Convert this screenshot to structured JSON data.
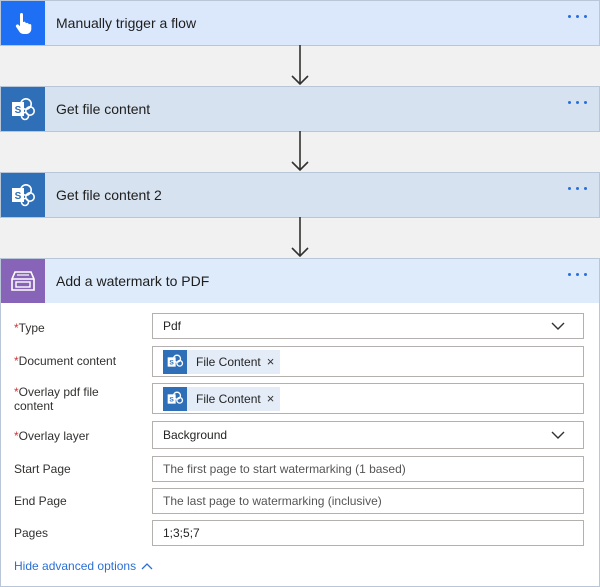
{
  "steps": [
    {
      "title": "Manually trigger a flow",
      "icon": "hand-pointer-icon"
    },
    {
      "title": "Get file content",
      "icon": "sharepoint-icon"
    },
    {
      "title": "Get file content 2",
      "icon": "sharepoint-icon"
    },
    {
      "title": "Add a watermark to PDF",
      "icon": "archive-icon"
    }
  ],
  "form": {
    "type": {
      "label": "Type",
      "value": "Pdf"
    },
    "document_content": {
      "label": "Document content",
      "token": "File Content"
    },
    "overlay_pdf": {
      "label": "Overlay pdf file content",
      "token": "File Content"
    },
    "overlay_layer": {
      "label": "Overlay layer",
      "value": "Background"
    },
    "start_page": {
      "label": "Start Page",
      "placeholder": "The first page to start watermarking (1 based)"
    },
    "end_page": {
      "label": "End Page",
      "placeholder": "The last page to watermarking (inclusive)"
    },
    "pages": {
      "label": "Pages",
      "value": "1;3;5;7"
    },
    "required_marker": "*",
    "token_remove": "×"
  },
  "advanced_link": "Hide advanced options",
  "colors": {
    "trigger_icon_bg": "#1f6ff5",
    "sharepoint_bg": "#2e6fb7",
    "watermark_icon_bg": "#8764b8",
    "link": "#2b6fd6"
  }
}
